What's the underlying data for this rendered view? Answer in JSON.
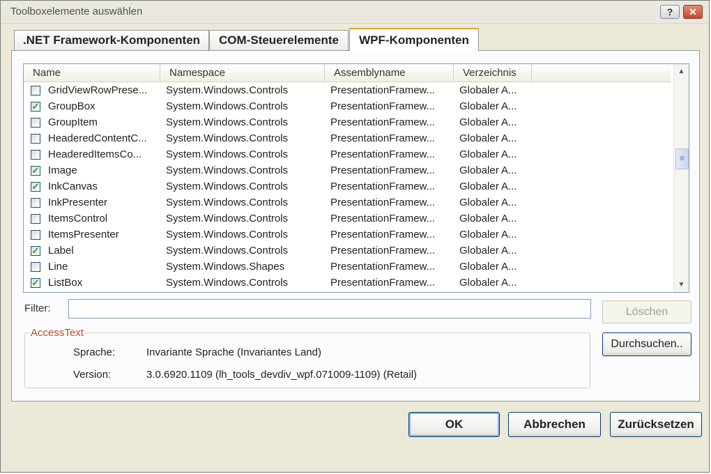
{
  "window": {
    "title": "Toolboxelemente auswählen",
    "help_label": "?",
    "close_label": "✕"
  },
  "tabs": [
    {
      "label": ".NET Framework-Komponenten",
      "active": false
    },
    {
      "label": "COM-Steuerelemente",
      "active": false
    },
    {
      "label": "WPF-Komponenten",
      "active": true
    }
  ],
  "list": {
    "columns": [
      "Name",
      "Namespace",
      "Assemblyname",
      "Verzeichnis"
    ],
    "rows": [
      {
        "checked": false,
        "name": "GridViewRowPrese...",
        "namespace": "System.Windows.Controls",
        "assembly": "PresentationFramew...",
        "directory": "Globaler A..."
      },
      {
        "checked": true,
        "name": "GroupBox",
        "namespace": "System.Windows.Controls",
        "assembly": "PresentationFramew...",
        "directory": "Globaler A..."
      },
      {
        "checked": false,
        "name": "GroupItem",
        "namespace": "System.Windows.Controls",
        "assembly": "PresentationFramew...",
        "directory": "Globaler A..."
      },
      {
        "checked": false,
        "name": "HeaderedContentC...",
        "namespace": "System.Windows.Controls",
        "assembly": "PresentationFramew...",
        "directory": "Globaler A..."
      },
      {
        "checked": false,
        "name": "HeaderedItemsCo...",
        "namespace": "System.Windows.Controls",
        "assembly": "PresentationFramew...",
        "directory": "Globaler A..."
      },
      {
        "checked": true,
        "name": "Image",
        "namespace": "System.Windows.Controls",
        "assembly": "PresentationFramew...",
        "directory": "Globaler A..."
      },
      {
        "checked": true,
        "name": "InkCanvas",
        "namespace": "System.Windows.Controls",
        "assembly": "PresentationFramew...",
        "directory": "Globaler A..."
      },
      {
        "checked": false,
        "name": "InkPresenter",
        "namespace": "System.Windows.Controls",
        "assembly": "PresentationFramew...",
        "directory": "Globaler A..."
      },
      {
        "checked": false,
        "name": "ItemsControl",
        "namespace": "System.Windows.Controls",
        "assembly": "PresentationFramew...",
        "directory": "Globaler A..."
      },
      {
        "checked": false,
        "name": "ItemsPresenter",
        "namespace": "System.Windows.Controls",
        "assembly": "PresentationFramew...",
        "directory": "Globaler A..."
      },
      {
        "checked": true,
        "name": "Label",
        "namespace": "System.Windows.Controls",
        "assembly": "PresentationFramew...",
        "directory": "Globaler A..."
      },
      {
        "checked": false,
        "name": "Line",
        "namespace": "System.Windows.Shapes",
        "assembly": "PresentationFramew...",
        "directory": "Globaler A..."
      },
      {
        "checked": true,
        "name": "ListBox",
        "namespace": "System.Windows.Controls",
        "assembly": "PresentationFramew...",
        "directory": "Globaler A..."
      }
    ]
  },
  "filter": {
    "label": "Filter:",
    "value": "",
    "clear_label": "Löschen"
  },
  "browse_label": "Durchsuchen..",
  "details": {
    "legend": "AccessText",
    "language_label": "Sprache:",
    "language_value": "Invariante Sprache (Invariantes Land)",
    "version_label": "Version:",
    "version_value": "3.0.6920.1109 (lh_tools_devdiv_wpf.071009-1109) (Retail)"
  },
  "footer": {
    "ok_label": "OK",
    "cancel_label": "Abbrechen",
    "reset_label": "Zurücksetzen"
  },
  "colors": {
    "legend_text": "#b44c2a",
    "check_mark": "#21a121",
    "active_tab_accent": "#f0a035"
  }
}
